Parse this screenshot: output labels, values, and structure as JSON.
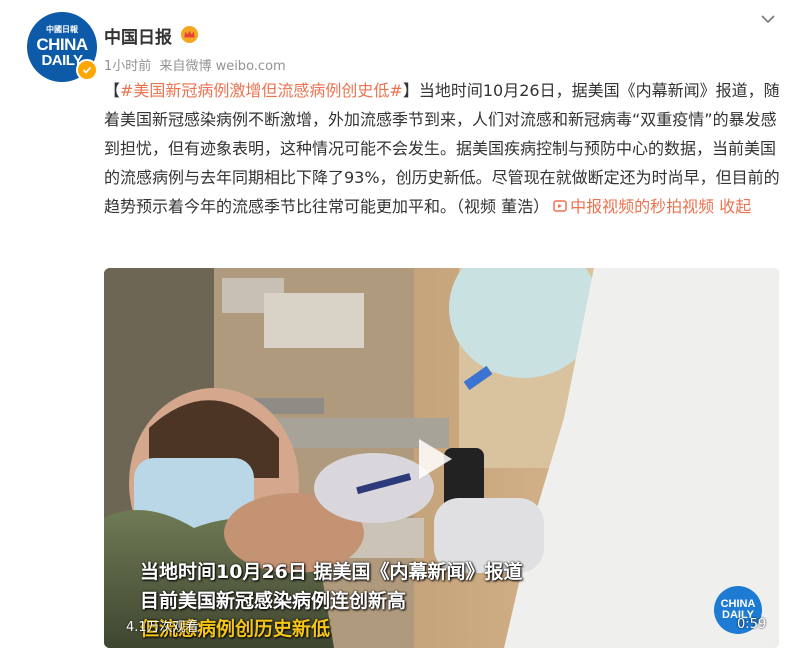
{
  "post": {
    "author": "中国日报",
    "time": "1小时前",
    "source_prefix": "来自",
    "source": "微博 weibo.com",
    "avatar": {
      "top": "中國日報",
      "line1": "CHINA",
      "line2": "DAILY"
    },
    "verified_color": "#ffa500"
  },
  "content": {
    "bracket_open": "【",
    "hashtag": "#美国新冠病例激增但流感病例创史低#",
    "bracket_close": "】",
    "body": "当地时间10月26日，据美国《内幕新闻》报道，随着美国新冠感染病例不断激增，外加流感季节到来，人们对流感和新冠病毒“双重疫情”的暴发感到担忧，但有迹象表明，这种情况可能不会发生。据美国疾病控制与预防中心的数据，当前美国的流感病例与去年同期相比下降了93%，创历史新低。尽管现在就做断定还为时尚早，但目前的趋势预示着今年的流感季节比往常可能更加平和。（视频 董浩）",
    "video_link": "中报视频的秒拍视频",
    "collapse": "收起",
    "link_color": "#eb7350"
  },
  "video": {
    "subtitle1": "当地时间10月26日 据美国《内幕新闻》报道",
    "subtitle2": "目前美国新冠感染病例连创新高",
    "subtitle3_highlight": "但流感病例创历史新低",
    "views": "4.1万次观看",
    "duration": "0:59",
    "logo_line1": "CHINA",
    "logo_line2": "DAILY"
  }
}
